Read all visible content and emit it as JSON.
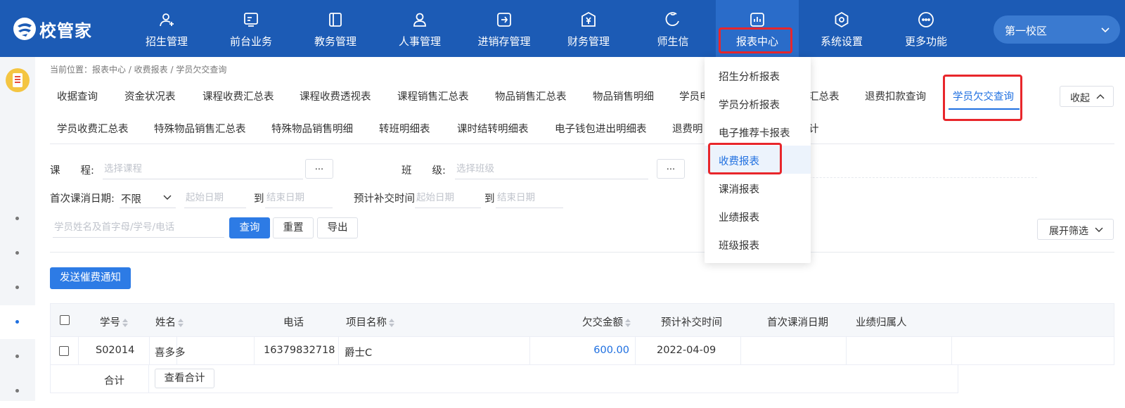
{
  "header": {
    "logo_text": "校管家",
    "nav": [
      {
        "label": "招生管理",
        "icon": "user-add-icon"
      },
      {
        "label": "前台业务",
        "icon": "monitor-icon"
      },
      {
        "label": "教务管理",
        "icon": "book-icon"
      },
      {
        "label": "人事管理",
        "icon": "person-icon"
      },
      {
        "label": "进销存管理",
        "icon": "arrow-box-icon"
      },
      {
        "label": "财务管理",
        "icon": "yen-icon"
      },
      {
        "label": "师生信",
        "icon": "chat-icon"
      },
      {
        "label": "报表中心",
        "icon": "bar-chart-icon",
        "active": true
      },
      {
        "label": "系统设置",
        "icon": "settings-icon"
      },
      {
        "label": "更多功能",
        "icon": "more-icon"
      }
    ],
    "campus": "第一校区"
  },
  "breadcrumb": "当前位置：报表中心 / 收费报表 / 学员欠交查询",
  "tabs_row1": [
    "收据查询",
    "资金状况表",
    "课程收费汇总表",
    "课程收费透视表",
    "课程销售汇总表",
    "物品销售汇总表",
    "物品销售明细",
    "学员电",
    "汇总表",
    "退费扣款查询",
    "学员欠交查询"
  ],
  "tabs_row2": [
    "学员收费汇总表",
    "特殊物品销售汇总表",
    "特殊物品销售明细",
    "转班明细表",
    "课时结转明细表",
    "电子钱包进出明细表",
    "退费明",
    "计"
  ],
  "collapse_label": "收起",
  "filters": {
    "course_label": "课　　程:",
    "course_placeholder": "选择课程",
    "class_label": "班　　级:",
    "class_placeholder": "选择班级",
    "dots": "...",
    "first_consume_label": "首次课消日期:",
    "first_consume_value": "不限",
    "start_placeholder": "起始日期",
    "end_placeholder": "结束日期",
    "to": "到",
    "expected_label": "预计补交时间",
    "search_placeholder": "学员姓名及首字母/学号/电话",
    "query": "查询",
    "reset": "重置",
    "export": "导出",
    "expand": "展开筛选"
  },
  "send_notice": "发送催费通知",
  "table": {
    "headers": [
      "学号",
      "姓名",
      "电话",
      "项目名称",
      "欠交金额",
      "预计补交时间",
      "首次课消日期",
      "业绩归属人"
    ],
    "rows": [
      {
        "id": "S02014",
        "name": "喜多多",
        "phone": "16379832718",
        "item": "爵士C",
        "amount": "600.00",
        "expected": "2022-04-09",
        "first": "",
        "owner": ""
      }
    ],
    "total_label": "合计",
    "view_total": "查看合计"
  },
  "dropdown": [
    "招生分析报表",
    "学员分析报表",
    "电子推荐卡报表",
    "收费报表",
    "课消报表",
    "业绩报表",
    "班级报表"
  ],
  "colors": {
    "primary": "#1c5bb5",
    "accent": "#1e6fe0",
    "highlight": "#e8262b"
  }
}
